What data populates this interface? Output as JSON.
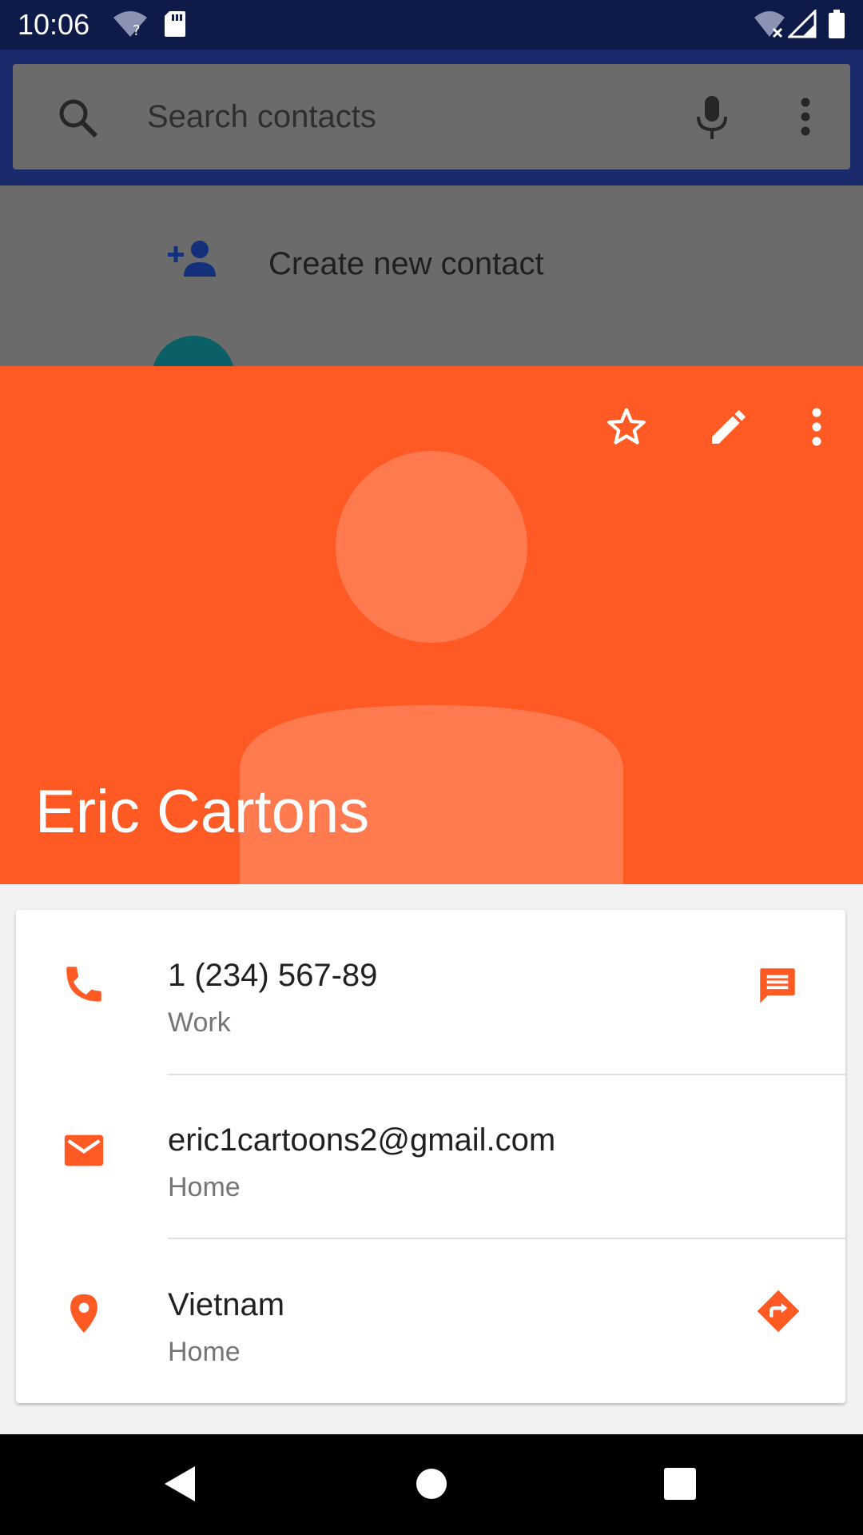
{
  "status_bar": {
    "time": "10:06",
    "icons": [
      "wifi-unknown-icon",
      "sd-card-icon",
      "wifi-off-icon",
      "signal-icon",
      "battery-icon"
    ]
  },
  "search": {
    "placeholder": "Search contacts",
    "icons": [
      "search-icon",
      "mic-icon",
      "more-vert-icon"
    ]
  },
  "list_peek": {
    "create_label": "Create new contact",
    "icon": "add-person-icon"
  },
  "contact": {
    "name": "Eric Cartons",
    "actions": [
      "star-outline-icon",
      "edit-icon",
      "more-vert-icon"
    ],
    "details": [
      {
        "icon": "phone-icon",
        "value": "1 (234) 567-89",
        "type": "Work",
        "action_icon": "message-icon"
      },
      {
        "icon": "email-icon",
        "value": "eric1cartoons2@gmail.com",
        "type": "Home",
        "action_icon": ""
      },
      {
        "icon": "location-icon",
        "value": "Vietnam",
        "type": "Home",
        "action_icon": "directions-icon"
      }
    ]
  },
  "colors": {
    "accent": "#ff5a23",
    "status_bar": "#0e1a48",
    "header_bg": "#1a2a6c",
    "scrim": "#6b6b6b"
  },
  "nav_bar": {
    "buttons": [
      "back-icon",
      "home-icon",
      "recents-icon"
    ]
  }
}
